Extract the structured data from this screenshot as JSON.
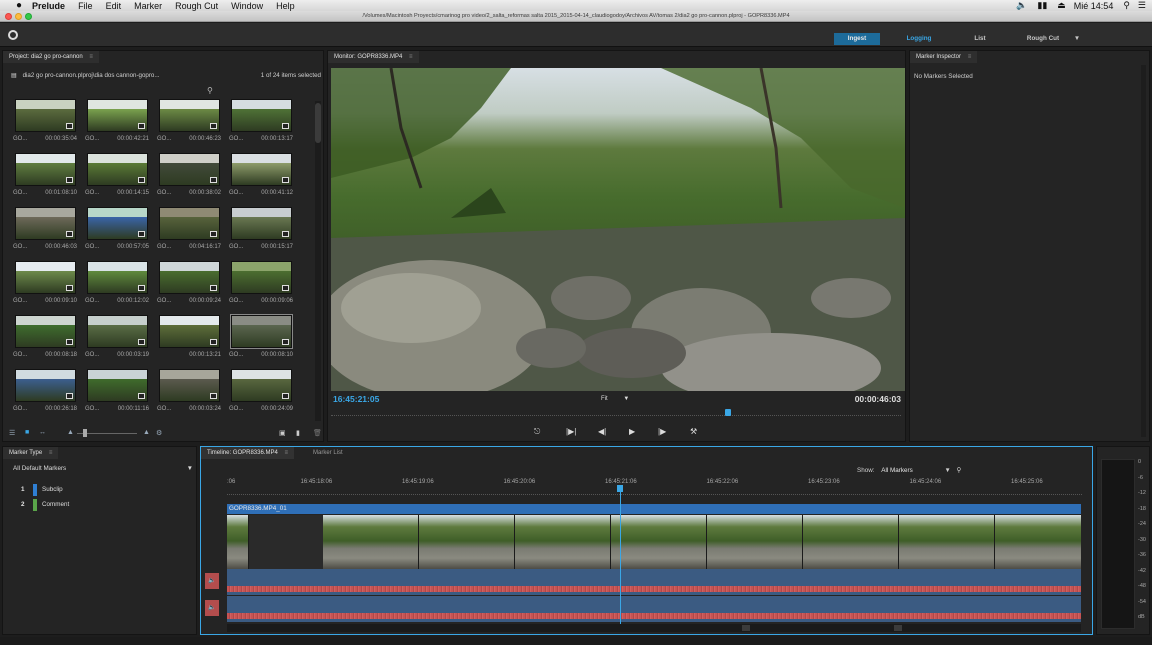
{
  "menubar": {
    "apple": "",
    "app_name": "Prelude",
    "menus": [
      "File",
      "Edit",
      "Marker",
      "Rough Cut",
      "Window",
      "Help"
    ],
    "clock": "Mié 14:54"
  },
  "window": {
    "title": "/Volumes/Macintosh Proyects/cmarinog pro video/2_salta_reformas salta 2015_2015-04-14_claudiogodoy/Archivos AV/tomas 2/dia2 go pro-cannon.plproj - GOPR8336.MP4"
  },
  "workspaces": {
    "ingest": "Ingest",
    "logging": "Logging",
    "list": "List",
    "rough_cut": "Rough Cut"
  },
  "project": {
    "tab": "Project: dia2 go pro-cannon",
    "path": "dia2 go pro-cannon.plproj\\dia dos cannon-gopro...",
    "count": "1 of 24 items selected",
    "clips": [
      {
        "name": "GO...",
        "tc": "00:00:35:04"
      },
      {
        "name": "GO...",
        "tc": "00:00:42:21"
      },
      {
        "name": "GO...",
        "tc": "00:00:46:23"
      },
      {
        "name": "GO...",
        "tc": "00:00:13:17"
      },
      {
        "name": "GO...",
        "tc": "00:01:08:10"
      },
      {
        "name": "GO...",
        "tc": "00:00:14:15"
      },
      {
        "name": "GO...",
        "tc": "00:00:38:02"
      },
      {
        "name": "GO...",
        "tc": "00:00:41:12"
      },
      {
        "name": "GO...",
        "tc": "00:00:46:03"
      },
      {
        "name": "GO...",
        "tc": "00:00:57:05"
      },
      {
        "name": "GO...",
        "tc": "00:04:16:17"
      },
      {
        "name": "GO...",
        "tc": "00:00:15:17"
      },
      {
        "name": "GO...",
        "tc": "00:00:09:10"
      },
      {
        "name": "GO...",
        "tc": "00:00:12:02"
      },
      {
        "name": "GO...",
        "tc": "00:00:09:24"
      },
      {
        "name": "GO...",
        "tc": "00:00:09:06"
      },
      {
        "name": "GO...",
        "tc": "00:00:08:18"
      },
      {
        "name": "GO...",
        "tc": "00:00:03:19"
      },
      {
        "name": "",
        "tc": "00:00:13:21"
      },
      {
        "name": "GO...",
        "tc": "00:00:08:10"
      },
      {
        "name": "GO...",
        "tc": "00:00:26:18"
      },
      {
        "name": "GO...",
        "tc": "00:00:11:16"
      },
      {
        "name": "GO...",
        "tc": "00:00:03:24"
      },
      {
        "name": "GO...",
        "tc": "00:00:24:09"
      }
    ]
  },
  "monitor": {
    "tab": "Monitor: GOPR8336.MP4",
    "current_tc": "16:45:21:05",
    "duration_tc": "00:00:46:03",
    "fit": "Fit"
  },
  "inspector": {
    "tab": "Marker Inspector",
    "status": "No Markers Selected"
  },
  "marker_type": {
    "tab": "Marker Type",
    "dropdown": "All Default Markers",
    "items": [
      {
        "num": "1",
        "label": "Subclip",
        "color": "#2f7fd3"
      },
      {
        "num": "2",
        "label": "Comment",
        "color": "#5aa54a"
      }
    ]
  },
  "timeline": {
    "tab": "Timeline: GOPR8336.MP4",
    "tab2": "Marker List",
    "show_label": "Show:",
    "show_value": "All Markers",
    "ruler": [
      ":06",
      "16:45:18:06",
      "16:45:19:06",
      "16:45:20:06",
      "16:45:21:06",
      "16:45:22:06",
      "16:45:23:06",
      "16:45:24:06",
      "16:45:25:06"
    ],
    "clip_name": "GOPR8336.MP4_01"
  },
  "meter": {
    "labels": [
      "0",
      "-6",
      "-12",
      "-18",
      "-24",
      "-30",
      "-36",
      "-42",
      "-48",
      "-54",
      "dB"
    ]
  },
  "colors": {
    "accent": "#3aa7e6",
    "ingest_bg": "#1d6b9a",
    "audio": "#3b5b82",
    "audio_wave": "#c65454",
    "clip_bar": "#2f6fb7"
  }
}
